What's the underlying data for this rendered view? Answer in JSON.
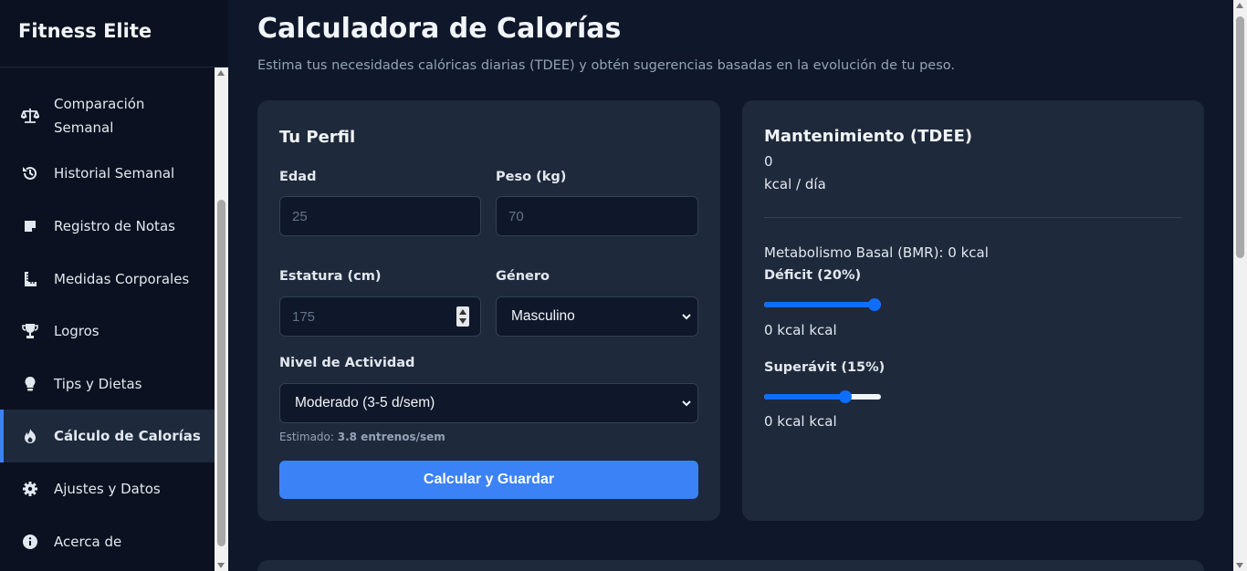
{
  "app": {
    "brand": "Fitness Elite"
  },
  "sidebar": {
    "items": [
      {
        "label_line1": "Comparación",
        "label_line2": "Semanal",
        "icon": "scale-icon"
      },
      {
        "label": "Historial Semanal",
        "icon": "history-icon"
      },
      {
        "label": "Registro de Notas",
        "icon": "note-icon"
      },
      {
        "label": "Medidas Corporales",
        "icon": "ruler-icon"
      },
      {
        "label": "Logros",
        "icon": "trophy-icon"
      },
      {
        "label": "Tips y Dietas",
        "icon": "lightbulb-icon"
      },
      {
        "label": "Cálculo de Calorías",
        "icon": "fire-icon",
        "active": true
      },
      {
        "label": "Ajustes y Datos",
        "icon": "gear-icon"
      },
      {
        "label": "Acerca de",
        "icon": "info-icon"
      }
    ]
  },
  "header": {
    "title": "Calculadora de Calorías",
    "subtitle": "Estima tus necesidades calóricas diarias (TDEE) y obtén sugerencias basadas en la evolución de tu peso."
  },
  "profile": {
    "title": "Tu Perfil",
    "age_label": "Edad",
    "age_placeholder": "25",
    "weight_label": "Peso (kg)",
    "weight_placeholder": "70",
    "height_label": "Estatura (cm)",
    "height_placeholder": "175",
    "gender_label": "Género",
    "gender_value": "Masculino",
    "activity_label": "Nivel de Actividad",
    "activity_value": "Moderado (3-5 d/sem)",
    "estimate_prefix": "Estimado:",
    "estimate_value": "3.8 entrenos/sem",
    "submit_label": "Calcular y Guardar"
  },
  "results": {
    "title": "Mantenimiento (TDEE)",
    "tdee_value": "0",
    "tdee_unit": "kcal / día",
    "bmr_text": "Metabolismo Basal (BMR): 0 kcal",
    "deficit_label": "Déficit (20%)",
    "deficit_slider_fraction": 1.0,
    "deficit_value": "0 kcal kcal",
    "surplus_label": "Superávit (15%)",
    "surplus_slider_fraction": 0.72,
    "surplus_value": "0 kcal kcal"
  },
  "colors": {
    "accent": "#3b82f6",
    "slider": "#0d6efd",
    "background": "#0f172a",
    "card": "#1e293b",
    "sidebar": "#0b1120"
  }
}
